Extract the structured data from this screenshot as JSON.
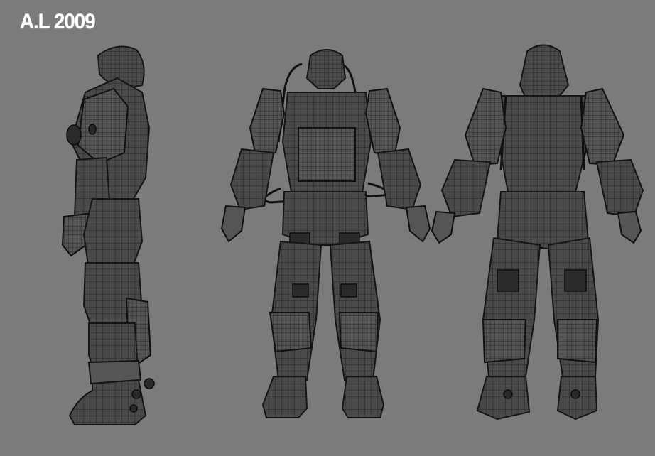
{
  "watermark": {
    "text": "A.L 2009"
  },
  "colors": {
    "background": "#7b7b7b",
    "wireframe": "#151515",
    "mesh_fill": "#4a4a4a"
  },
  "views": [
    {
      "name": "side-view"
    },
    {
      "name": "front-view"
    },
    {
      "name": "back-view"
    }
  ]
}
